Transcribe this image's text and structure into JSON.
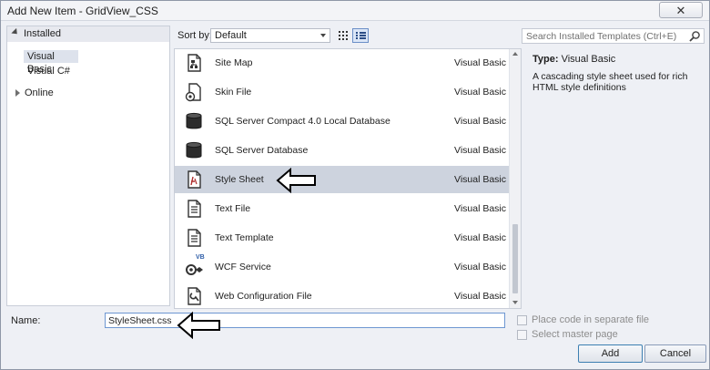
{
  "window": {
    "title": "Add New Item - GridView_CSS",
    "close_glyph": "✕"
  },
  "tree": {
    "installed": "Installed",
    "items": [
      "Visual Basic",
      "Visual C#"
    ],
    "online": "Online"
  },
  "toolbar": {
    "sort_label": "Sort by:",
    "sort_value": "Default",
    "search_placeholder": "Search Installed Templates (Ctrl+E)"
  },
  "templates": [
    {
      "name": "Site Map",
      "language": "Visual Basic",
      "icon": "site-map-icon"
    },
    {
      "name": "Skin File",
      "language": "Visual Basic",
      "icon": "skin-file-icon"
    },
    {
      "name": "SQL Server Compact 4.0 Local Database",
      "language": "Visual Basic",
      "icon": "database-icon"
    },
    {
      "name": "SQL Server Database",
      "language": "Visual Basic",
      "icon": "database-icon"
    },
    {
      "name": "Style Sheet",
      "language": "Visual Basic",
      "icon": "style-sheet-icon",
      "selected": true
    },
    {
      "name": "Text File",
      "language": "Visual Basic",
      "icon": "text-file-icon"
    },
    {
      "name": "Text Template",
      "language": "Visual Basic",
      "icon": "text-template-icon"
    },
    {
      "name": "WCF Service",
      "language": "Visual Basic",
      "icon": "wcf-service-icon",
      "badge": "VB"
    },
    {
      "name": "Web Configuration File",
      "language": "Visual Basic",
      "icon": "web-config-icon"
    }
  ],
  "details": {
    "type_label": "Type:",
    "type_value": "Visual Basic",
    "description": "A cascading style sheet used for rich HTML style definitions"
  },
  "form": {
    "name_label": "Name:",
    "name_value": "StyleSheet.css",
    "place_code_label": "Place code in separate file",
    "master_page_label": "Select master page",
    "add_label": "Add",
    "cancel_label": "Cancel"
  },
  "colors": {
    "selection": "#cdd3de",
    "window_bg": "#eef0f5",
    "focus_border": "#6e97d1"
  }
}
